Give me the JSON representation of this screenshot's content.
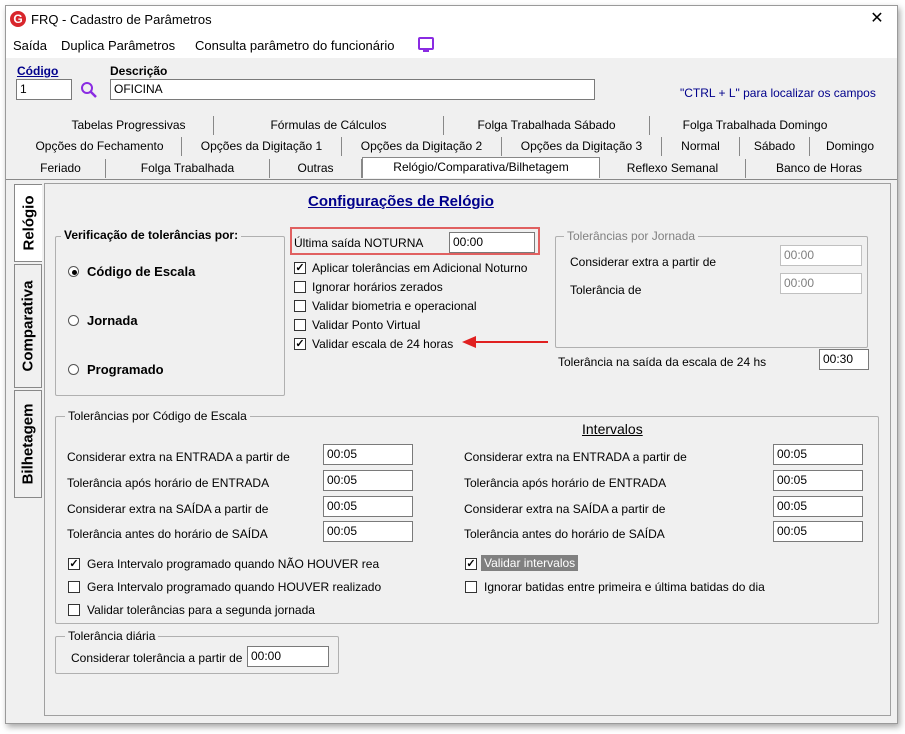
{
  "window": {
    "title": "FRQ - Cadastro de Parâmetros",
    "logo": "G"
  },
  "menu": {
    "items": [
      "Saída",
      "Duplica Parâmetros",
      "Consulta parâmetro do funcionário"
    ]
  },
  "header": {
    "codigo_label": "Código",
    "codigo_value": "1",
    "descricao_label": "Descrição",
    "descricao_value": "OFICINA",
    "hint": "\"CTRL + L\" para localizar os campos"
  },
  "tabs": {
    "row1": [
      "Tabelas Progressivas",
      "Fórmulas de Cálculos",
      "Folga Trabalhada Sábado",
      "Folga Trabalhada Domingo"
    ],
    "row2": [
      "Opções do Fechamento",
      "Opções da Digitação 1",
      "Opções da Digitação 2",
      "Opções da Digitação 3",
      "Normal",
      "Sábado",
      "Domingo"
    ],
    "row3": [
      "Feriado",
      "Folga Trabalhada",
      "Outras",
      "Relógio/Comparativa/Bilhetagem",
      "Reflexo Semanal",
      "Banco de Horas"
    ]
  },
  "vtabs": [
    "Relógio",
    "Comparativa",
    "Bilhetagem"
  ],
  "section_title": "Configurações de Relógio",
  "verif": {
    "label": "Verificação de tolerâncias por:",
    "options": [
      "Código de Escala",
      "Jornada",
      "Programado"
    ],
    "selected": "Código de Escala"
  },
  "ultima": {
    "label": "Última saída NOTURNA",
    "value": "00:00"
  },
  "checks": [
    {
      "label": "Aplicar tolerâncias em Adicional Noturno",
      "checked": true
    },
    {
      "label": "Ignorar horários zerados",
      "checked": false
    },
    {
      "label": "Validar biometria e operacional",
      "checked": false
    },
    {
      "label": "Validar Ponto Virtual",
      "checked": false
    },
    {
      "label": "Validar escala de 24 horas",
      "checked": true
    }
  ],
  "jornada": {
    "label": "Tolerâncias por Jornada",
    "extra_label": "Considerar extra a partir de",
    "extra_value": "00:00",
    "tol_label": "Tolerância de",
    "tol_value": "00:00"
  },
  "tol24": {
    "label": "Tolerância na saída da escala de 24 hs",
    "value": "00:30"
  },
  "escala": {
    "label": "Tolerâncias por Código de Escala",
    "intervalos_label": "Intervalos",
    "left": [
      {
        "label": "Considerar extra na ENTRADA a partir de",
        "value": "00:05"
      },
      {
        "label": "Tolerância após horário de ENTRADA",
        "value": "00:05"
      },
      {
        "label": "Considerar extra na SAÍDA a partir de",
        "value": "00:05"
      },
      {
        "label": "Tolerância antes do horário de SAÍDA",
        "value": "00:05"
      }
    ],
    "right": [
      {
        "label": "Considerar extra na ENTRADA a partir de",
        "value": "00:05"
      },
      {
        "label": "Tolerância após horário de ENTRADA",
        "value": "00:05"
      },
      {
        "label": "Considerar extra na SAÍDA a partir de",
        "value": "00:05"
      },
      {
        "label": "Tolerância antes do horário de SAÍDA",
        "value": "00:05"
      }
    ],
    "left_checks": [
      {
        "label": "Gera Intervalo programado quando NÃO HOUVER rea",
        "checked": true
      },
      {
        "label": "Gera Intervalo programado quando HOUVER realizado",
        "checked": false
      },
      {
        "label": "Validar tolerâncias para a segunda jornada",
        "checked": false
      }
    ],
    "right_checks": [
      {
        "label": "Validar intervalos",
        "checked": true
      },
      {
        "label": "Ignorar batidas entre primeira e última batidas do dia",
        "checked": false
      }
    ]
  },
  "diaria": {
    "label": "Tolerância diária",
    "field_label": "Considerar tolerância a partir de",
    "value": "00:00"
  },
  "colors": {
    "highlight_box": "#e06060",
    "arrow": "#e02020",
    "selected_check_bg": "#808080",
    "title_blue": "#00008b"
  },
  "icons": [
    "logo-icon",
    "close-icon",
    "monitor-icon",
    "search-icon",
    "arrow-annotation"
  ]
}
